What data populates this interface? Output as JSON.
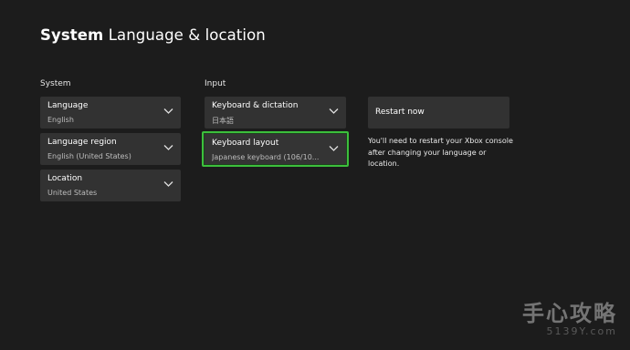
{
  "header": {
    "title_bold": "System",
    "title_light": "Language & location"
  },
  "sections": {
    "system_label": "System",
    "input_label": "Input"
  },
  "system": {
    "language": {
      "label": "Language",
      "value": "English"
    },
    "region": {
      "label": "Language region",
      "value": "English (United States)"
    },
    "location": {
      "label": "Location",
      "value": "United States"
    }
  },
  "input": {
    "keyboard_dictation": {
      "label": "Keyboard & dictation",
      "value": "日本語"
    },
    "keyboard_layout": {
      "label": "Keyboard layout",
      "value": "Japanese keyboard (106/10..."
    }
  },
  "restart": {
    "button_label": "Restart now",
    "note": "You'll need to restart your Xbox console after changing your language or location."
  },
  "watermark": {
    "main": "手心攻略",
    "sub": "5139Y.com"
  },
  "colors": {
    "background": "#1c1c1c",
    "tile": "#323232",
    "focus": "#3cbf3c"
  },
  "icons": {
    "dropdown": "chevron-down-icon"
  }
}
